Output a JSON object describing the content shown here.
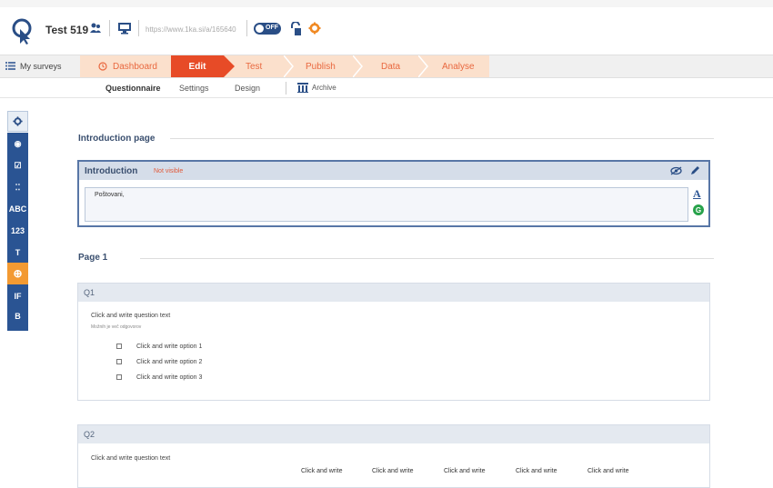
{
  "app": {
    "survey_title": "Test 519",
    "url": "https://www.1ka.si/a/165640",
    "toggle_label": "OFF"
  },
  "colors": {
    "accent": "#e74b27",
    "step_bg": "#fbe0cc",
    "sidebar": "#2a5493",
    "tool_highlight": "#f39a32"
  },
  "nav": {
    "my_surveys": "My surveys",
    "steps": [
      {
        "label": "Dashboard",
        "active": false
      },
      {
        "label": "Edit",
        "active": true
      },
      {
        "label": "Test",
        "active": false
      },
      {
        "label": "Publish",
        "active": false
      },
      {
        "label": "Data",
        "active": false
      },
      {
        "label": "Analyse",
        "active": false
      }
    ]
  },
  "subnav": {
    "questionnaire": "Questionnaire",
    "settings": "Settings",
    "design": "Design",
    "archive": "Archive"
  },
  "tools": [
    {
      "icon": "radio-icon",
      "label": "◉"
    },
    {
      "icon": "checkbox-icon",
      "label": "☑"
    },
    {
      "icon": "grid-icon",
      "label": "⁚⁚"
    },
    {
      "icon": "text-icon",
      "label": "ABC"
    },
    {
      "icon": "number-icon",
      "label": "123"
    },
    {
      "icon": "heading-icon",
      "label": "T"
    },
    {
      "icon": "add-circle-icon",
      "label": "⊕"
    },
    {
      "icon": "condition-icon",
      "label": "IF"
    },
    {
      "icon": "block-icon",
      "label": "B"
    }
  ],
  "content": {
    "intro_section": "Introduction page",
    "intro_title": "Introduction",
    "intro_status": "Not visible",
    "intro_text": "Poštovani,",
    "page1_section": "Page 1",
    "q1": {
      "label": "Q1",
      "text": "Click and write question text",
      "hint": "Možnih je več odgovorov",
      "options": [
        "Click and write option 1",
        "Click and write option 2",
        "Click and write option 3"
      ]
    },
    "q2": {
      "label": "Q2",
      "text": "Click and write question text",
      "columns": [
        "Click and write",
        "Click and write",
        "Click and write",
        "Click and write",
        "Click and write"
      ]
    }
  }
}
